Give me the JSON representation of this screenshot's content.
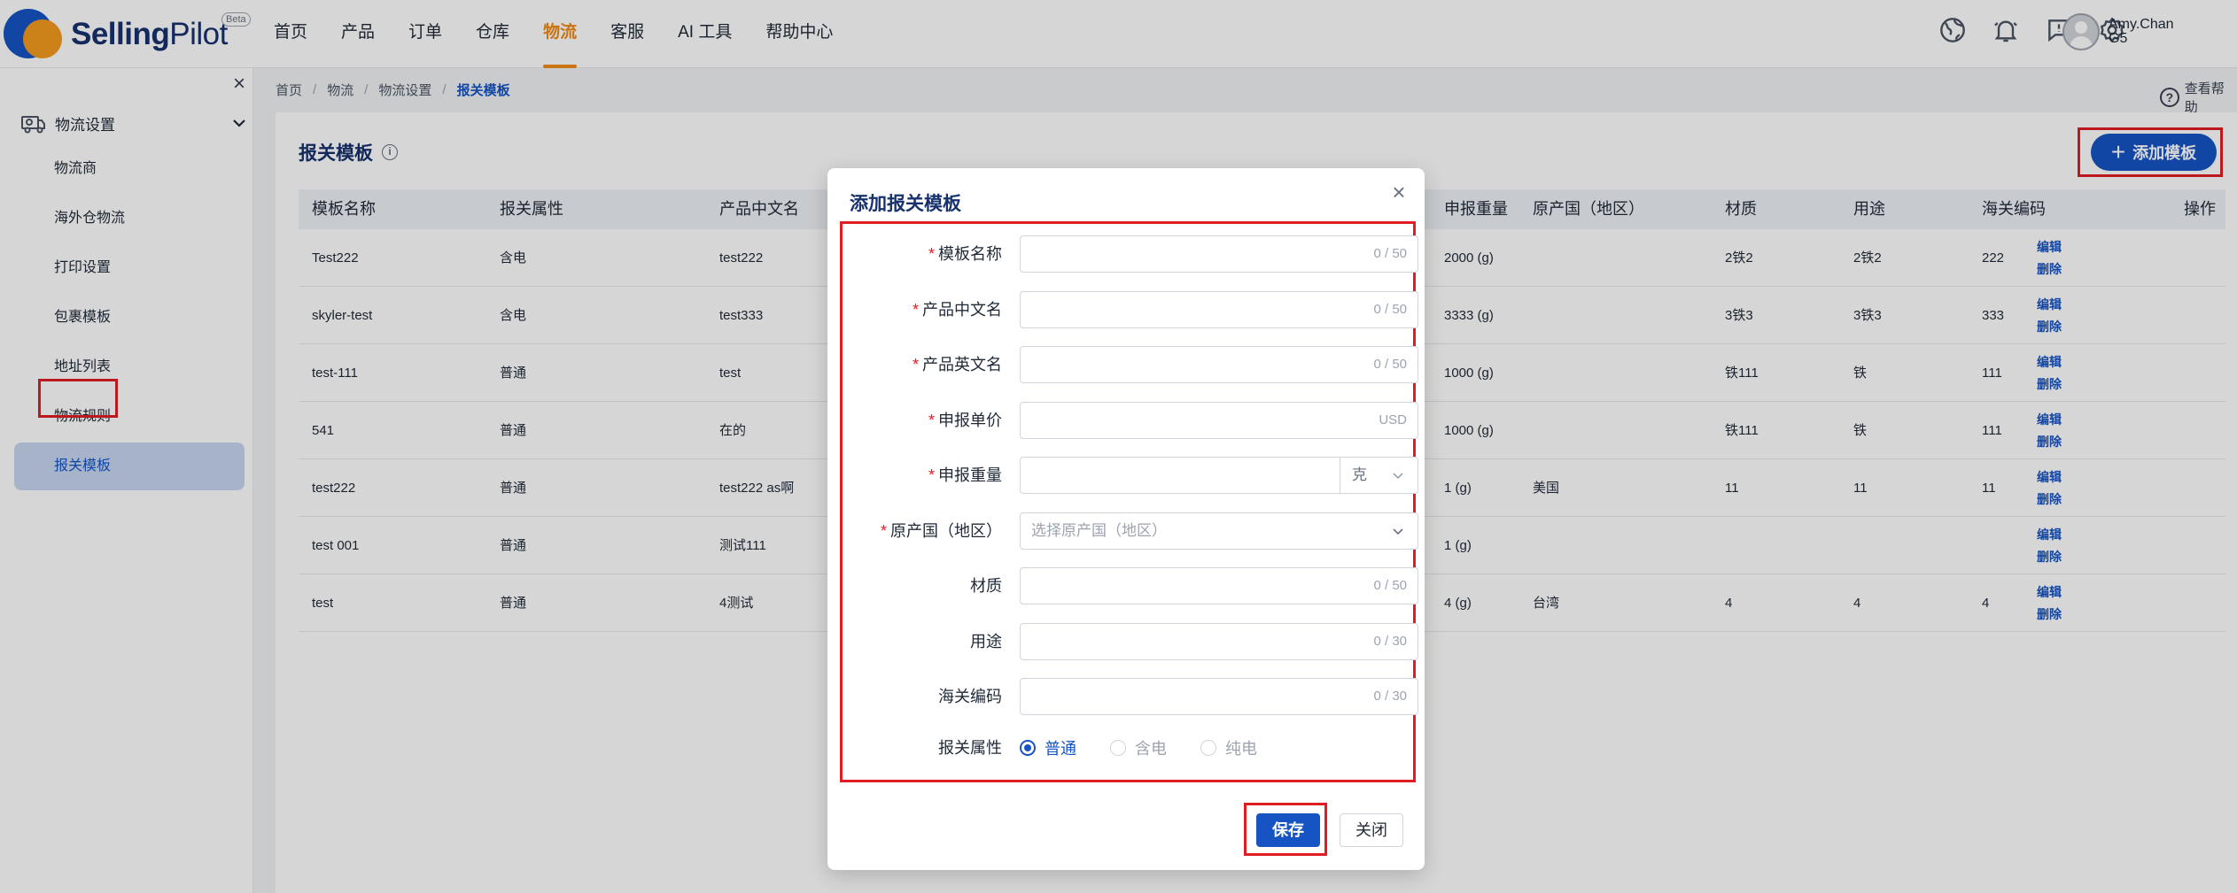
{
  "brand": {
    "name_bold": "Selling",
    "name_light": "Pilot",
    "badge": "Beta"
  },
  "nav": {
    "items": [
      {
        "label": "首页"
      },
      {
        "label": "产品"
      },
      {
        "label": "订单"
      },
      {
        "label": "仓库"
      },
      {
        "label": "物流",
        "active": true
      },
      {
        "label": "客服"
      },
      {
        "label": "AI 工具"
      },
      {
        "label": "帮助中心"
      }
    ]
  },
  "user": {
    "name": "Amy.Chan",
    "sub": "G5"
  },
  "sidebar": {
    "group_label": "物流设置",
    "items": [
      {
        "label": "物流商"
      },
      {
        "label": "海外仓物流"
      },
      {
        "label": "打印设置"
      },
      {
        "label": "包裹模板"
      },
      {
        "label": "地址列表"
      },
      {
        "label": "物流规则"
      },
      {
        "label": "报关模板",
        "active": true
      }
    ]
  },
  "breadcrumb": {
    "items": [
      "首页",
      "物流",
      "物流设置"
    ],
    "current": "报关模板"
  },
  "help_label": "查看帮助",
  "page": {
    "title": "报关模板",
    "add_button": "添加模板"
  },
  "table": {
    "headers": [
      "模板名称",
      "报关属性",
      "产品中文名",
      "申报重量",
      "原产国（地区）",
      "材质",
      "用途",
      "海关编码",
      "操作"
    ],
    "rows": [
      {
        "name": "Test222",
        "attr": "含电",
        "cn": "test222",
        "weight": "2000 (g)",
        "origin": "",
        "material": "2铁2",
        "usage": "2铁2",
        "hs": "222"
      },
      {
        "name": "skyler-test",
        "attr": "含电",
        "cn": "test333",
        "weight": "3333 (g)",
        "origin": "",
        "material": "3铁3",
        "usage": "3铁3",
        "hs": "333"
      },
      {
        "name": "test-111",
        "attr": "普通",
        "cn": "test",
        "weight": "1000 (g)",
        "origin": "",
        "material": "铁111",
        "usage": "铁",
        "hs": "111"
      },
      {
        "name": "541",
        "attr": "普通",
        "cn": "在的",
        "weight": "1000 (g)",
        "origin": "",
        "material": "铁111",
        "usage": "铁",
        "hs": "111"
      },
      {
        "name": "test222",
        "attr": "普通",
        "cn": "test222 as啊",
        "weight": "1 (g)",
        "origin": "美国",
        "material": "11",
        "usage": "11",
        "hs": "11"
      },
      {
        "name": "test 001",
        "attr": "普通",
        "cn": "测试111",
        "weight": "1 (g)",
        "origin": "",
        "material": "",
        "usage": "",
        "hs": ""
      },
      {
        "name": "test",
        "attr": "普通",
        "cn": "4测试",
        "weight": "4 (g)",
        "origin": "台湾",
        "material": "4",
        "usage": "4",
        "hs": "4"
      }
    ],
    "op_edit": "编辑",
    "op_delete": "删除"
  },
  "modal": {
    "title": "添加报关模板",
    "fields": [
      {
        "label": "模板名称",
        "required": true,
        "type": "text",
        "counter": "0 / 50"
      },
      {
        "label": "产品中文名",
        "required": true,
        "type": "text",
        "counter": "0 / 50"
      },
      {
        "label": "产品英文名",
        "required": true,
        "type": "text",
        "counter": "0 / 50"
      },
      {
        "label": "申报单价",
        "required": true,
        "type": "text",
        "counter": "USD"
      },
      {
        "label": "申报重量",
        "required": true,
        "type": "unit",
        "unit": "克"
      },
      {
        "label": "原产国（地区）",
        "required": true,
        "type": "select",
        "placeholder": "选择原产国（地区）"
      },
      {
        "label": "材质",
        "required": false,
        "type": "text",
        "counter": "0 / 50"
      },
      {
        "label": "用途",
        "required": false,
        "type": "text",
        "counter": "0 / 30"
      },
      {
        "label": "海关编码",
        "required": false,
        "type": "text",
        "counter": "0 / 30"
      }
    ],
    "attr_label": "报关属性",
    "attr_options": [
      {
        "label": "普通",
        "selected": true
      },
      {
        "label": "含电",
        "selected": false
      },
      {
        "label": "纯电",
        "selected": false
      }
    ],
    "save_label": "保存",
    "close_label": "关闭"
  },
  "colors": {
    "primary": "#1654c4",
    "accent": "#f08a17",
    "highlight": "#e11d24"
  }
}
